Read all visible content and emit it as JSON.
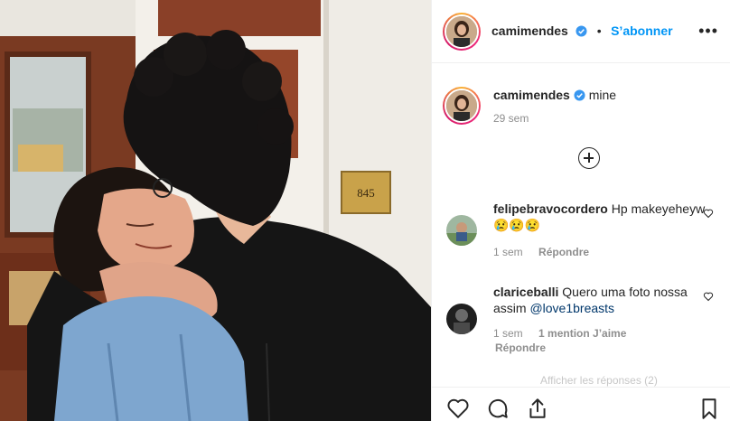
{
  "header": {
    "username": "camimendes",
    "separator": "•",
    "follow_label": "S’abonner",
    "more_icon": "more-options-icon",
    "verified_icon": "verified-badge-icon"
  },
  "post": {
    "plaque_number": "845"
  },
  "caption": {
    "username": "camimendes",
    "text": "mine",
    "time": "29 sem"
  },
  "load_more_icon": "plus-circle-icon",
  "comments": [
    {
      "username": "felipebravocordero",
      "text": "Hp makeyeheyw",
      "emoji": "😢😢😢",
      "time": "1 sem",
      "reply_label": "Répondre"
    },
    {
      "username": "clariceballi",
      "text": "Quero uma foto nossa assim",
      "mention": "@love1breasts",
      "time": "1 sem",
      "likes": "1 mention J’aime",
      "reply_label": "Répondre"
    }
  ],
  "faded_text": "Afficher les réponses (2)",
  "actions": {
    "like_icon": "heart-icon",
    "comment_icon": "comment-icon",
    "share_icon": "share-icon",
    "save_icon": "bookmark-icon"
  },
  "colors": {
    "link_blue": "#0095f6",
    "verified_blue": "#3897f0",
    "muted": "#8e8e8e"
  }
}
